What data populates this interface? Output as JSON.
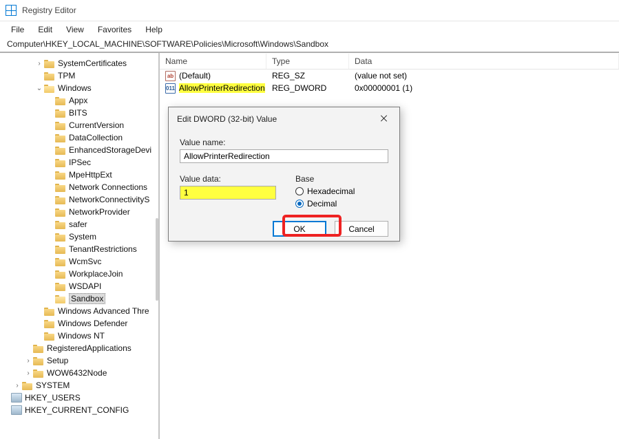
{
  "titlebar": {
    "title": "Registry Editor"
  },
  "menubar": [
    "File",
    "Edit",
    "View",
    "Favorites",
    "Help"
  ],
  "addressbar": "Computer\\HKEY_LOCAL_MACHINE\\SOFTWARE\\Policies\\Microsoft\\Windows\\Sandbox",
  "tree": [
    {
      "indent": 3,
      "toggle": ">",
      "icon": "folder",
      "label": "SystemCertificates"
    },
    {
      "indent": 3,
      "toggle": "",
      "icon": "folder",
      "label": "TPM"
    },
    {
      "indent": 3,
      "toggle": "v",
      "icon": "folder-open",
      "label": "Windows"
    },
    {
      "indent": 4,
      "toggle": "",
      "icon": "folder",
      "label": "Appx"
    },
    {
      "indent": 4,
      "toggle": "",
      "icon": "folder",
      "label": "BITS"
    },
    {
      "indent": 4,
      "toggle": "",
      "icon": "folder",
      "label": "CurrentVersion"
    },
    {
      "indent": 4,
      "toggle": "",
      "icon": "folder",
      "label": "DataCollection"
    },
    {
      "indent": 4,
      "toggle": "",
      "icon": "folder",
      "label": "EnhancedStorageDevi"
    },
    {
      "indent": 4,
      "toggle": "",
      "icon": "folder",
      "label": "IPSec"
    },
    {
      "indent": 4,
      "toggle": "",
      "icon": "folder",
      "label": "MpeHttpExt"
    },
    {
      "indent": 4,
      "toggle": "",
      "icon": "folder",
      "label": "Network Connections"
    },
    {
      "indent": 4,
      "toggle": "",
      "icon": "folder",
      "label": "NetworkConnectivityS"
    },
    {
      "indent": 4,
      "toggle": "",
      "icon": "folder",
      "label": "NetworkProvider"
    },
    {
      "indent": 4,
      "toggle": "",
      "icon": "folder",
      "label": "safer"
    },
    {
      "indent": 4,
      "toggle": "",
      "icon": "folder",
      "label": "System"
    },
    {
      "indent": 4,
      "toggle": "",
      "icon": "folder",
      "label": "TenantRestrictions"
    },
    {
      "indent": 4,
      "toggle": "",
      "icon": "folder",
      "label": "WcmSvc"
    },
    {
      "indent": 4,
      "toggle": "",
      "icon": "folder",
      "label": "WorkplaceJoin"
    },
    {
      "indent": 4,
      "toggle": "",
      "icon": "folder",
      "label": "WSDAPI"
    },
    {
      "indent": 4,
      "toggle": "",
      "icon": "folder-open",
      "label": "Sandbox",
      "selected": true
    },
    {
      "indent": 3,
      "toggle": "",
      "icon": "folder",
      "label": "Windows Advanced Thre"
    },
    {
      "indent": 3,
      "toggle": "",
      "icon": "folder",
      "label": "Windows Defender"
    },
    {
      "indent": 3,
      "toggle": "",
      "icon": "folder",
      "label": "Windows NT"
    },
    {
      "indent": 2,
      "toggle": "",
      "icon": "folder",
      "label": "RegisteredApplications"
    },
    {
      "indent": 2,
      "toggle": ">",
      "icon": "folder",
      "label": "Setup"
    },
    {
      "indent": 2,
      "toggle": ">",
      "icon": "folder",
      "label": "WOW6432Node"
    },
    {
      "indent": 1,
      "toggle": ">",
      "icon": "folder",
      "label": "SYSTEM"
    },
    {
      "indent": 0,
      "toggle": "",
      "icon": "pc",
      "label": "HKEY_USERS"
    },
    {
      "indent": 0,
      "toggle": "",
      "icon": "pc",
      "label": "HKEY_CURRENT_CONFIG"
    }
  ],
  "list": {
    "headers": {
      "name": "Name",
      "type": "Type",
      "data": "Data"
    },
    "rows": [
      {
        "icon": "ab",
        "name": "(Default)",
        "type": "REG_SZ",
        "data": "(value not set)",
        "hl": false
      },
      {
        "icon": "dw",
        "name": "AllowPrinterRedirection",
        "type": "REG_DWORD",
        "data": "0x00000001 (1)",
        "hl": true
      }
    ]
  },
  "dialog": {
    "title": "Edit DWORD (32-bit) Value",
    "value_name_label": "Value name:",
    "value_name": "AllowPrinterRedirection",
    "value_data_label": "Value data:",
    "value_data": "1",
    "base_label": "Base",
    "radio_hex": "Hexadecimal",
    "radio_dec": "Decimal",
    "selected_base": "Decimal",
    "ok": "OK",
    "cancel": "Cancel"
  }
}
